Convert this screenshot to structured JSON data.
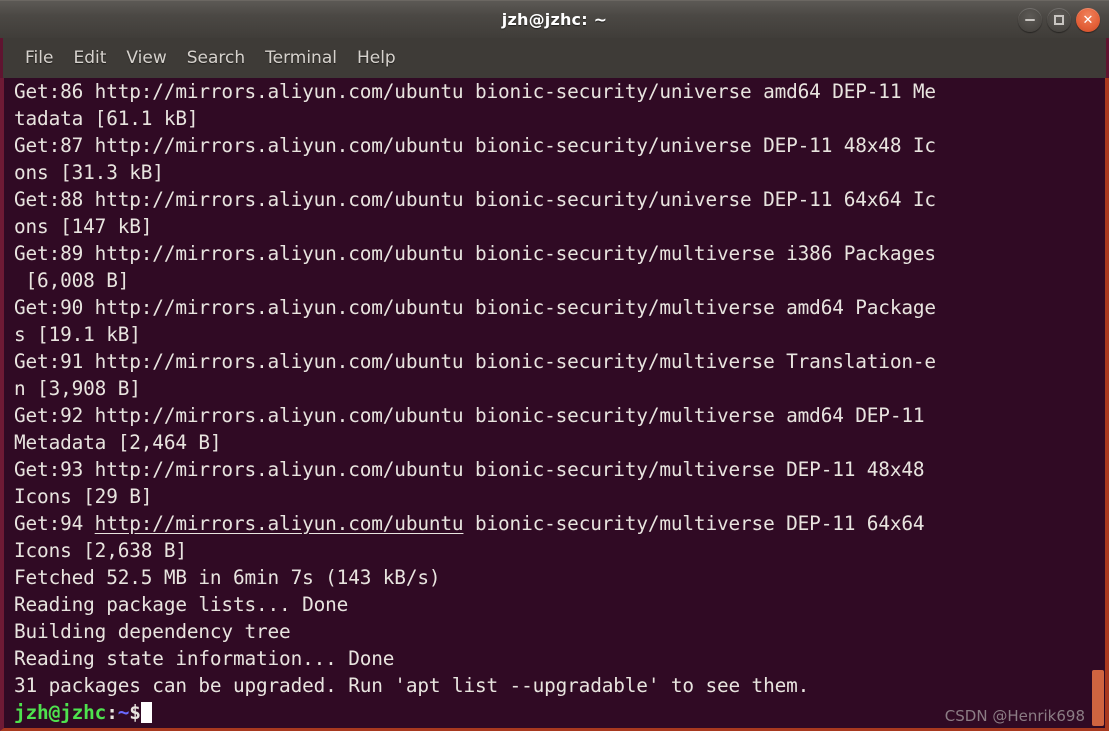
{
  "window": {
    "title": "jzh@jzhc: ~",
    "controls": [
      {
        "name": "minimize",
        "glyph": "—"
      },
      {
        "name": "maximize",
        "glyph": "▫"
      },
      {
        "name": "close",
        "glyph": "✕"
      }
    ]
  },
  "menubar": {
    "items": [
      "File",
      "Edit",
      "View",
      "Search",
      "Terminal",
      "Help"
    ]
  },
  "terminal": {
    "background_color": "#300a24",
    "foreground_color": "#e8e4df",
    "prompt_user_color": "#4ee24e",
    "prompt_path_color": "#6a6aff",
    "cursor_color": "#ffffff",
    "lines": [
      "Get:86 http://mirrors.aliyun.com/ubuntu bionic-security/universe amd64 DEP-11 Me",
      "tadata [61.1 kB]",
      "Get:87 http://mirrors.aliyun.com/ubuntu bionic-security/universe DEP-11 48x48 Ic",
      "ons [31.3 kB]",
      "Get:88 http://mirrors.aliyun.com/ubuntu bionic-security/universe DEP-11 64x64 Ic",
      "ons [147 kB]",
      "Get:89 http://mirrors.aliyun.com/ubuntu bionic-security/multiverse i386 Packages",
      " [6,008 B]",
      "Get:90 http://mirrors.aliyun.com/ubuntu bionic-security/multiverse amd64 Package",
      "s [19.1 kB]",
      "Get:91 http://mirrors.aliyun.com/ubuntu bionic-security/multiverse Translation-e",
      "n [3,908 B]",
      "Get:92 http://mirrors.aliyun.com/ubuntu bionic-security/multiverse amd64 DEP-11",
      "Metadata [2,464 B]",
      "Get:93 http://mirrors.aliyun.com/ubuntu bionic-security/multiverse DEP-11 48x48",
      "Icons [29 B]",
      "Icons [2,638 B]",
      "Fetched 52.5 MB in 6min 7s (143 kB/s)",
      "Reading package lists... Done",
      "Building dependency tree",
      "Reading state information... Done",
      "31 packages can be upgraded. Run 'apt list --upgradable' to see them."
    ],
    "link_line": {
      "prefix": "Get:94 ",
      "url": "http://mirrors.aliyun.com/ubuntu",
      "suffix": " bionic-security/multiverse DEP-11 64x64"
    },
    "prompt": {
      "user_host": "jzh@jzhc",
      "separator": ":",
      "path": "~",
      "sigil": "$",
      "input": ""
    }
  },
  "watermark": {
    "text": "CSDN @Henrik698"
  }
}
